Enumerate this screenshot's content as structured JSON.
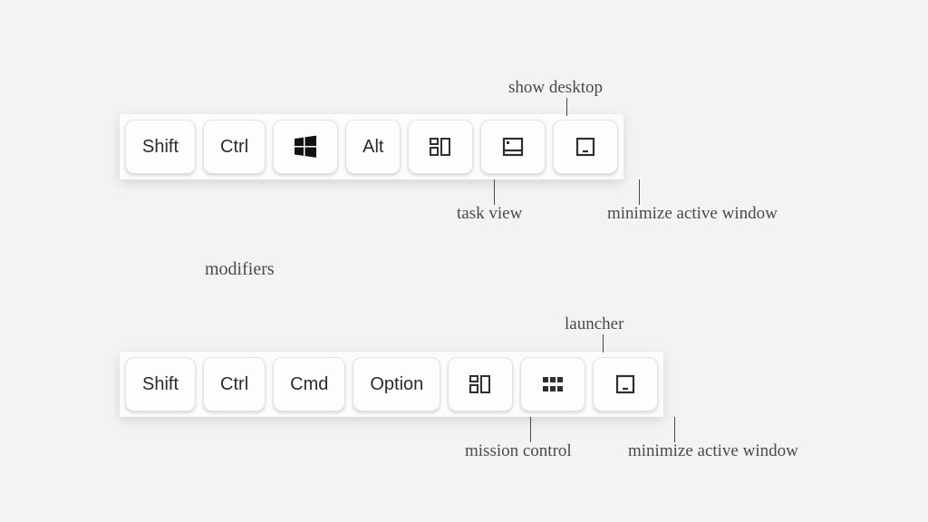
{
  "colors": {
    "bg": "#f2f3f3",
    "panel": "#fcfcfc",
    "key": "#fdfdfd",
    "text": "#4a4a47",
    "icon": "#2f2f2f"
  },
  "section_label": "modifiers",
  "rows": [
    {
      "platform": "windows",
      "keys": [
        {
          "type": "text",
          "label": "Shift"
        },
        {
          "type": "text",
          "label": "Ctrl"
        },
        {
          "type": "icon",
          "icon": "windows-logo-icon"
        },
        {
          "type": "text",
          "label": "Alt"
        },
        {
          "type": "icon",
          "icon": "task-view-icon",
          "annotation": "task view"
        },
        {
          "type": "icon",
          "icon": "show-desktop-icon",
          "annotation": "show desktop"
        },
        {
          "type": "icon",
          "icon": "minimize-window-icon",
          "annotation": "minimize active window"
        }
      ]
    },
    {
      "platform": "mac",
      "keys": [
        {
          "type": "text",
          "label": "Shift"
        },
        {
          "type": "text",
          "label": "Ctrl"
        },
        {
          "type": "text",
          "label": "Cmd"
        },
        {
          "type": "text",
          "label": "Option"
        },
        {
          "type": "icon",
          "icon": "mission-control-icon",
          "annotation": "mission control"
        },
        {
          "type": "icon",
          "icon": "launcher-icon",
          "annotation": "launcher"
        },
        {
          "type": "icon",
          "icon": "minimize-window-icon",
          "annotation": "minimize active window"
        }
      ]
    }
  ]
}
